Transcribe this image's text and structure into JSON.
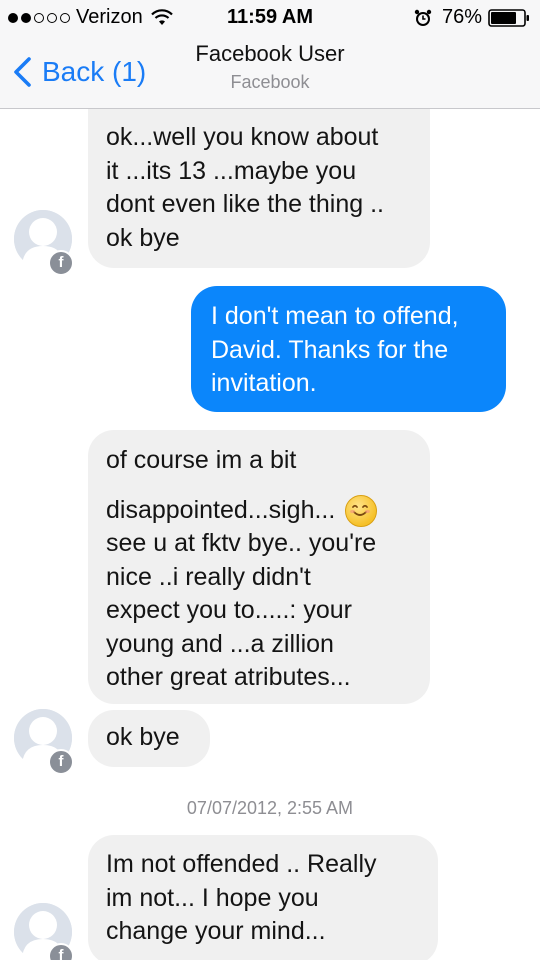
{
  "status_bar": {
    "carrier": "Verizon",
    "time": "11:59 AM",
    "battery": "76%",
    "signal_bars_filled": 2,
    "signal_bars_total": 5
  },
  "nav": {
    "back_label": "Back (1)",
    "title": "Facebook User",
    "subtitle": "Facebook"
  },
  "colors": {
    "accent": "#1a7cf6",
    "outgoing_bubble": "#0b86fb",
    "incoming_bubble": "#f0f0f0"
  },
  "messages": [
    {
      "from": "them",
      "lines": [
        "ok...well you know about",
        "it ...its 13 ...maybe you",
        "dont even like the thing ..",
        "ok bye"
      ]
    },
    {
      "from": "me",
      "lines": [
        "I don't mean to offend,",
        "David. Thanks for the",
        "invitation."
      ]
    },
    {
      "from": "them",
      "lines": [
        "of course im a bit",
        "disappointed...sigh...",
        "see u at fktv bye.. you're",
        "nice  ..i really didn't",
        "expect you to.....: your",
        "young and  ...a zillion",
        "other great atributes..."
      ]
    },
    {
      "from": "them",
      "lines": [
        "ok bye"
      ]
    },
    {
      "from": "them",
      "lines": [
        "Im  not  offended .. Really",
        "im not... I hope you",
        "change your mind..."
      ]
    }
  ],
  "timestamp": "07/07/2012, 2:55 AM",
  "icons": {
    "emoji": "smiling-face-emoji",
    "badge": "facebook-f-badge"
  }
}
